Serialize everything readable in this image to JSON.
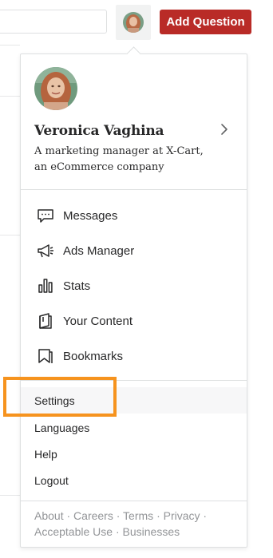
{
  "header": {
    "add_question_label": "Add Question"
  },
  "profile": {
    "name": "Veronica Vaghina",
    "description": "A marketing manager at X-Cart, an eCommerce company"
  },
  "menu": [
    {
      "label": "Messages",
      "icon": "messages-icon"
    },
    {
      "label": "Ads Manager",
      "icon": "megaphone-icon"
    },
    {
      "label": "Stats",
      "icon": "bar-chart-icon"
    },
    {
      "label": "Your Content",
      "icon": "book-icon"
    },
    {
      "label": "Bookmarks",
      "icon": "bookmark-icon"
    }
  ],
  "secondary_menu": [
    {
      "label": "Settings",
      "highlighted": true
    },
    {
      "label": "Languages"
    },
    {
      "label": "Help"
    },
    {
      "label": "Logout"
    }
  ],
  "footer_links": [
    "About",
    "Careers",
    "Terms",
    "Privacy",
    "Acceptable Use",
    "Businesses"
  ],
  "colors": {
    "brand_red": "#b92b27",
    "highlight_orange": "#f6931e",
    "text": "#282829",
    "muted": "#939598"
  }
}
